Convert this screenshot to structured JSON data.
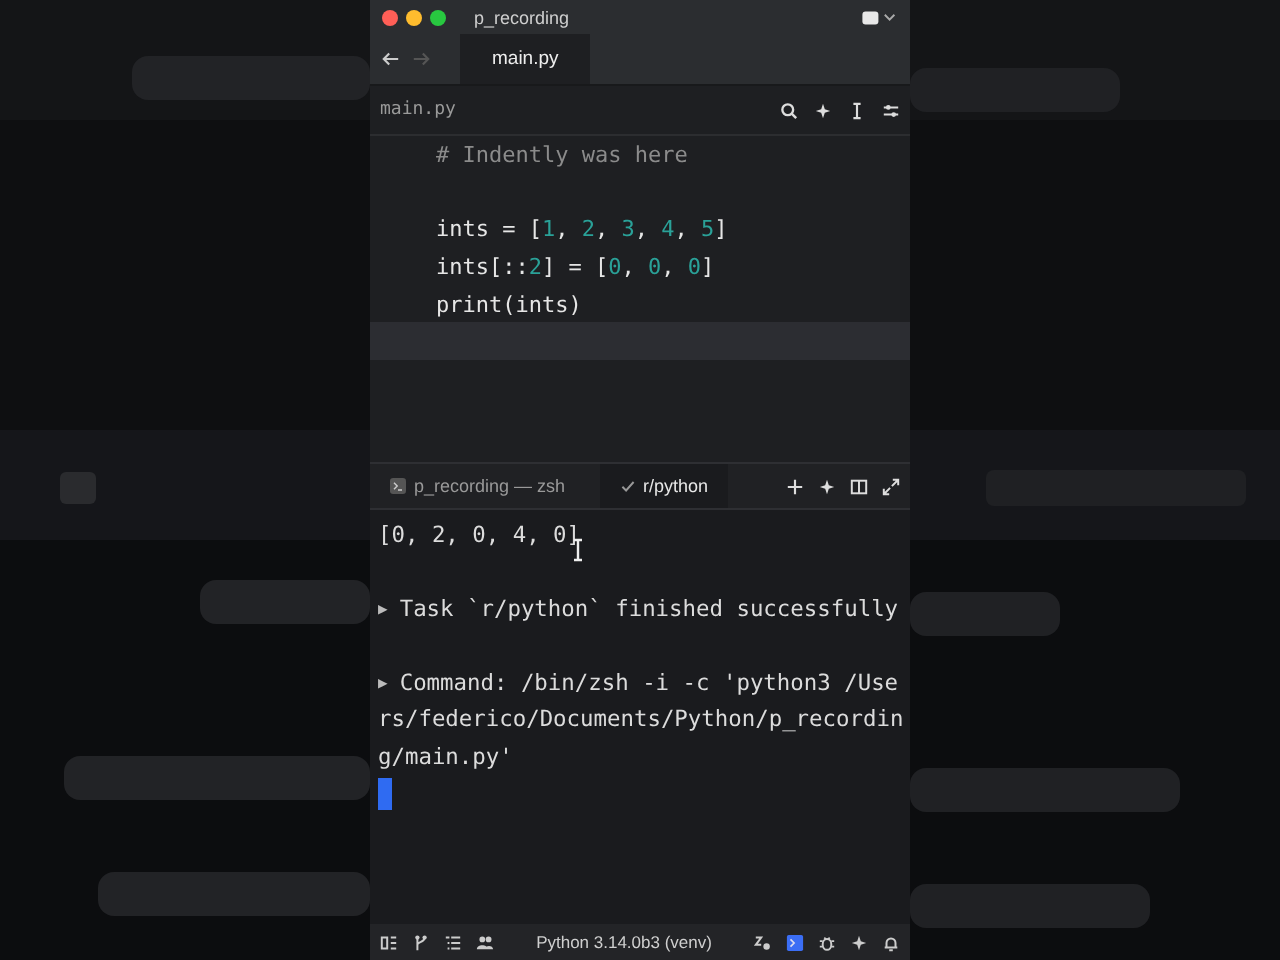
{
  "window": {
    "title": "p_recording"
  },
  "tabs": [
    {
      "label": "main.py",
      "selected": true
    }
  ],
  "breadcrumb": {
    "label": "main.py"
  },
  "editor": {
    "lines": [
      {
        "kind": "code",
        "current": false,
        "tokens": [
          {
            "kind": "comment",
            "text": "# Indently was here"
          }
        ]
      },
      {
        "kind": "blank",
        "current": false
      },
      {
        "kind": "code",
        "current": false,
        "tokens": [
          {
            "kind": "plain",
            "text": "ints = ["
          },
          {
            "kind": "number",
            "text": "1"
          },
          {
            "kind": "plain",
            "text": ", "
          },
          {
            "kind": "number",
            "text": "2"
          },
          {
            "kind": "plain",
            "text": ", "
          },
          {
            "kind": "number",
            "text": "3"
          },
          {
            "kind": "plain",
            "text": ", "
          },
          {
            "kind": "number",
            "text": "4"
          },
          {
            "kind": "plain",
            "text": ", "
          },
          {
            "kind": "number",
            "text": "5"
          },
          {
            "kind": "plain",
            "text": "]"
          }
        ]
      },
      {
        "kind": "code",
        "current": false,
        "tokens": [
          {
            "kind": "plain",
            "text": "ints[::"
          },
          {
            "kind": "number",
            "text": "2"
          },
          {
            "kind": "plain",
            "text": "] = ["
          },
          {
            "kind": "number",
            "text": "0"
          },
          {
            "kind": "plain",
            "text": ", "
          },
          {
            "kind": "number",
            "text": "0"
          },
          {
            "kind": "plain",
            "text": ", "
          },
          {
            "kind": "number",
            "text": "0"
          },
          {
            "kind": "plain",
            "text": "]"
          }
        ]
      },
      {
        "kind": "code",
        "current": false,
        "tokens": [
          {
            "kind": "plain",
            "text": "print(ints)"
          }
        ]
      },
      {
        "kind": "blank",
        "current": true
      }
    ]
  },
  "terminal": {
    "tabs": [
      {
        "kind": "shell",
        "label": "p_recording — zsh",
        "selected": false
      },
      {
        "kind": "task",
        "label": "r/python",
        "selected": true
      }
    ],
    "lines": [
      {
        "kind": "output",
        "text": "[0, 2, 0, 4, 0]"
      },
      {
        "kind": "blank"
      },
      {
        "kind": "task",
        "marker": "▶",
        "text": "Task `r/python` finished successfully"
      },
      {
        "kind": "blank"
      },
      {
        "kind": "task",
        "marker": "▶",
        "text": "Command: /bin/zsh -i -c 'python3 /Use"
      },
      {
        "kind": "output",
        "text": "rs/federico/Documents/Python/p_recordin"
      },
      {
        "kind": "output",
        "text": "g/main.py'"
      },
      {
        "kind": "cursor"
      }
    ]
  },
  "status_bar": {
    "interpreter": "Python 3.14.0b3 (venv)"
  }
}
